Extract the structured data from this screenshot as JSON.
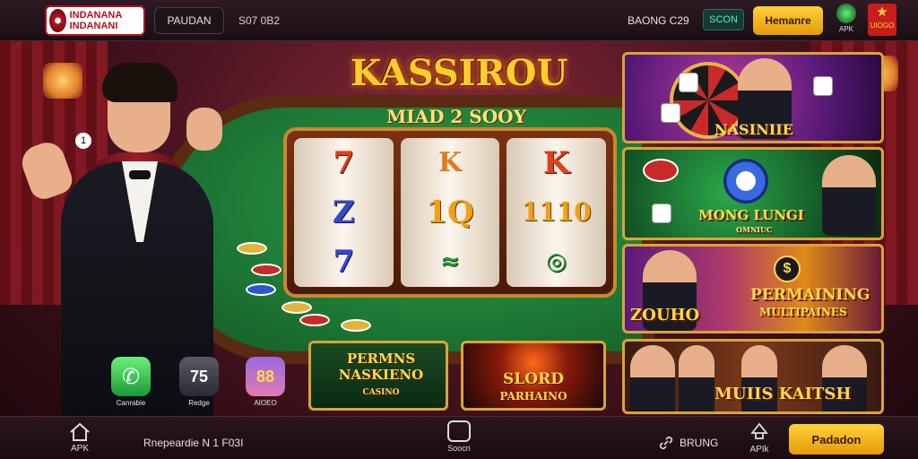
{
  "topbar": {
    "logo_text": "INDANANA INDANANI",
    "pill_label": "PAUDAN",
    "code": "S07 0B2",
    "balance": "BAONG C29",
    "balance_box": "SCON",
    "button_label": "Hemanre",
    "apk_label": "APK",
    "flag_label": "UIOGO"
  },
  "hero": {
    "title": "KASSIROU",
    "subtitle": "MIAD 2 SOOY",
    "hint": "1"
  },
  "slot": {
    "reels": [
      [
        "7",
        "Z",
        "7"
      ],
      [
        "K",
        "1Q",
        "≈"
      ],
      [
        "K",
        "1110",
        "◎"
      ]
    ]
  },
  "promos": [
    {
      "label": "NASINIIE"
    },
    {
      "label": "MONG LUNGI",
      "sublabel": "OMNIUC"
    },
    {
      "label": "PERMAINING",
      "sublabel": "MULTIPAINES",
      "side": "ZOUHO"
    },
    {
      "label": "MUIIS KAITSH"
    }
  ],
  "cards": {
    "left": {
      "label": "PERMNS NASKIENO",
      "sub": "CASINO"
    },
    "right": {
      "label": "SLORD",
      "sub": "PARHAINO"
    }
  },
  "apps": [
    {
      "label": "Canrabie",
      "glyph": "✆"
    },
    {
      "label": "Redge",
      "glyph": "75"
    },
    {
      "label": "AIOEO",
      "glyph": "88"
    }
  ],
  "bottombar": {
    "home_label": "APK",
    "text": "Rnepeardie N 1 F03I",
    "center_label": "Soocri",
    "link_label": "BRUNG",
    "apk_label": "APIk",
    "button_label": "Padadon"
  },
  "colors": {
    "accent_gold": "#ffcd2e",
    "button_gold": "#e59a0b",
    "felt_green": "#1e7a36",
    "background_red": "#4a1420"
  }
}
